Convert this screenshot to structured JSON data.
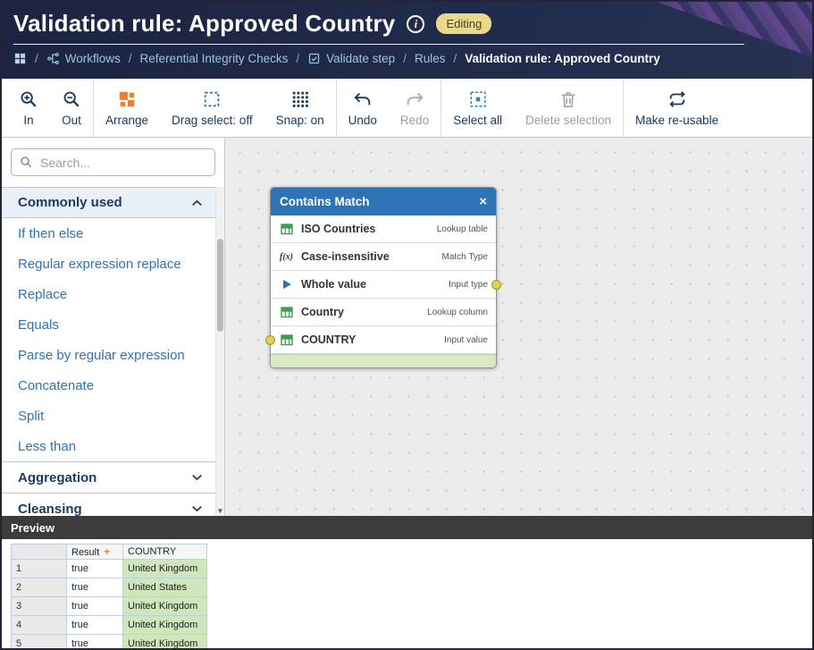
{
  "header": {
    "title": "Validation rule: Approved Country",
    "badge": "Editing",
    "breadcrumb": {
      "root_icon": "apps-grid-icon",
      "separator": "/",
      "items": [
        {
          "label": "Workflows",
          "icon": "workflow-icon",
          "current": false
        },
        {
          "label": "Referential Integrity Checks",
          "current": false
        },
        {
          "label": "Validate step",
          "icon": "validate-step-icon",
          "current": false
        },
        {
          "label": "Rules",
          "current": false
        },
        {
          "label": "Validation rule: Approved Country",
          "current": true
        }
      ]
    }
  },
  "toolbar": {
    "groups": [
      {
        "items": [
          {
            "label": "In",
            "icon": "zoom-in-icon",
            "enabled": true
          },
          {
            "label": "Out",
            "icon": "zoom-out-icon",
            "enabled": true
          }
        ]
      },
      {
        "items": [
          {
            "label": "Arrange",
            "icon": "arrange-icon",
            "enabled": true
          },
          {
            "label": "Drag select: off",
            "icon": "drag-select-icon",
            "enabled": true
          },
          {
            "label": "Snap: on",
            "icon": "snap-grid-icon",
            "enabled": true
          }
        ]
      },
      {
        "items": [
          {
            "label": "Undo",
            "icon": "undo-icon",
            "enabled": true
          },
          {
            "label": "Redo",
            "icon": "redo-icon",
            "enabled": false
          }
        ]
      },
      {
        "items": [
          {
            "label": "Select all",
            "icon": "select-all-icon",
            "enabled": true
          },
          {
            "label": "Delete selection",
            "icon": "trash-icon",
            "enabled": false
          }
        ]
      },
      {
        "items": [
          {
            "label": "Make re-usable",
            "icon": "reusable-icon",
            "enabled": true
          }
        ]
      }
    ]
  },
  "sidebar": {
    "search_placeholder": "Search...",
    "sections": [
      {
        "label": "Commonly used",
        "expanded": true,
        "items": [
          "If then else",
          "Regular expression replace",
          "Replace",
          "Equals",
          "Parse by regular expression",
          "Concatenate",
          "Split",
          "Less than"
        ]
      },
      {
        "label": "Aggregation",
        "expanded": false,
        "items": []
      },
      {
        "label": "Cleansing",
        "expanded": false,
        "items": []
      }
    ]
  },
  "node": {
    "title": "Contains Match",
    "close_glyph": "×",
    "rows": [
      {
        "name": "ISO Countries",
        "role": "Lookup table",
        "icon": "table-icon"
      },
      {
        "name": "Case-insensitive",
        "role": "Match Type",
        "icon": "function-icon"
      },
      {
        "name": "Whole value",
        "role": "Input type",
        "icon": "play-icon"
      },
      {
        "name": "Country",
        "role": "Lookup column",
        "icon": "table-icon"
      },
      {
        "name": "COUNTRY",
        "role": "Input value",
        "icon": "table-icon"
      }
    ]
  },
  "preview": {
    "title": "Preview",
    "table": {
      "columns": [
        {
          "label": "",
          "key": "corner"
        },
        {
          "label": "Result",
          "key": "result",
          "marker": "+"
        },
        {
          "label": "COUNTRY",
          "key": "country"
        }
      ],
      "rows": [
        {
          "num": "1",
          "result": "true",
          "country": "United Kingdom"
        },
        {
          "num": "2",
          "result": "true",
          "country": "United States"
        },
        {
          "num": "3",
          "result": "true",
          "country": "United Kingdom"
        },
        {
          "num": "4",
          "result": "true",
          "country": "United Kingdom"
        },
        {
          "num": "5",
          "result": "true",
          "country": "United Kingdom"
        }
      ]
    }
  },
  "colors": {
    "header_bg": "#1f2a47",
    "accent_blue": "#2e74b5",
    "badge_bg": "#ead98b",
    "toolbar_label": "#17375e",
    "node_footer_green": "#d9e9c6",
    "valid_cell_green": "#cfe6bd",
    "port_yellow": "#e4d04f",
    "arrange_orange": "#e8832a"
  }
}
